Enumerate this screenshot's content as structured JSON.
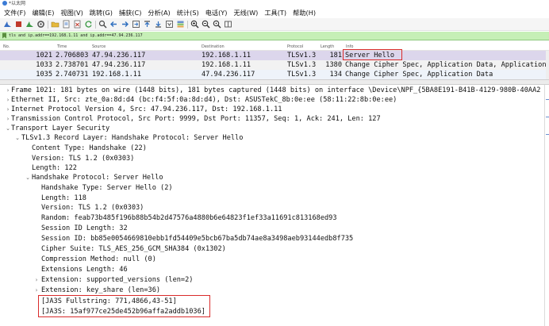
{
  "window": {
    "title": "*以太网"
  },
  "menu": [
    "文件(F)",
    "编辑(E)",
    "视图(V)",
    "跳转(G)",
    "捕获(C)",
    "分析(A)",
    "统计(S)",
    "电话(Y)",
    "无线(W)",
    "工具(T)",
    "帮助(H)"
  ],
  "toolbar": {
    "icons": [
      "shark-fin-icon",
      "stop-icon",
      "restart-icon",
      "options-gear-icon",
      "open-folder-icon",
      "save-file-icon",
      "close-file-icon",
      "reload-icon",
      "find-icon",
      "go-back-icon",
      "go-forward-icon",
      "jump-to-icon",
      "go-first-icon",
      "go-last-icon",
      "autoscroll-icon",
      "colorize-icon",
      "zoom-in-icon",
      "zoom-out-icon",
      "zoom-normal-icon",
      "resize-columns-icon"
    ]
  },
  "filter": {
    "text": "tls and ip.addr==192.168.1.11 and ip.addr==47.94.236.117"
  },
  "columns": {
    "no": "No.",
    "time": "Time",
    "source": "Source",
    "destination": "Destination",
    "protocol": "Protocol",
    "length": "Length",
    "info": "Info"
  },
  "packets": [
    {
      "no": "1021",
      "time": "2.706803",
      "source": "47.94.236.117",
      "destination": "192.168.1.11",
      "protocol": "TLSv1.3",
      "length": "181",
      "info": "Server Hello"
    },
    {
      "no": "1033",
      "time": "2.738701",
      "source": "47.94.236.117",
      "destination": "192.168.1.11",
      "protocol": "TLSv1.3",
      "length": "1380",
      "info": "Change Cipher Spec, Application Data, Application"
    },
    {
      "no": "1035",
      "time": "2.740731",
      "source": "192.168.1.11",
      "destination": "47.94.236.117",
      "protocol": "TLSv1.3",
      "length": "134",
      "info": "Change Cipher Spec, Application Data"
    }
  ],
  "details": [
    {
      "text": "Frame 1021: 181 bytes on wire (1448 bits), 181 bytes captured (1448 bits) on interface \\Device\\NPF_{5BA8E191-B41B-4129-980B-40AA2",
      "arrow": "›"
    },
    {
      "text": "Ethernet II, Src: zte_0a:8d:d4 (bc:f4:5f:0a:8d:d4), Dst: ASUSTekC_8b:0e:ee (58:11:22:8b:0e:ee)",
      "arrow": "›"
    },
    {
      "text": "Internet Protocol Version 4, Src: 47.94.236.117, Dst: 192.168.1.11",
      "arrow": "›"
    },
    {
      "text": "Transmission Control Protocol, Src Port: 9999, Dst Port: 11357, Seq: 1, Ack: 241, Len: 127",
      "arrow": "›"
    },
    {
      "text": "Transport Layer Security",
      "arrow": "⌄"
    },
    {
      "text": "TLSv1.3 Record Layer: Handshake Protocol: Server Hello",
      "arrow": "⌄"
    },
    {
      "text": "Content Type: Handshake (22)",
      "arrow": ""
    },
    {
      "text": "Version: TLS 1.2 (0x0303)",
      "arrow": ""
    },
    {
      "text": "Length: 122",
      "arrow": ""
    },
    {
      "text": "Handshake Protocol: Server Hello",
      "arrow": "⌄"
    },
    {
      "text": "Handshake Type: Server Hello (2)",
      "arrow": ""
    },
    {
      "text": "Length: 118",
      "arrow": ""
    },
    {
      "text": "Version: TLS 1.2 (0x0303)",
      "arrow": ""
    },
    {
      "text": "Random: feab73b485f196b88b54b2d47576a4880b6e64823f1ef33a11691c813168ed93",
      "arrow": ""
    },
    {
      "text": "Session ID Length: 32",
      "arrow": ""
    },
    {
      "text": "Session ID: bb85e0054669810ebb1fd54409e5bcb67ba5db74ae8a3498aeb93144edb8f735",
      "arrow": ""
    },
    {
      "text": "Cipher Suite: TLS_AES_256_GCM_SHA384 (0x1302)",
      "arrow": ""
    },
    {
      "text": "Compression Method: null (0)",
      "arrow": ""
    },
    {
      "text": "Extensions Length: 46",
      "arrow": ""
    },
    {
      "text": "Extension: supported_versions (len=2)",
      "arrow": "›"
    },
    {
      "text": "Extension: key_share (len=36)",
      "arrow": "›"
    },
    {
      "text": "[JA3S Fullstring: 771,4866,43-51]",
      "arrow": ""
    },
    {
      "text": "[JA3S: 15af977ce25de452b96affa2addb1036]",
      "arrow": ""
    }
  ],
  "colors": {
    "filter_bg": "#c6efb6",
    "selected_row": "#dcd6ec",
    "highlight_box": "#d92b2b"
  }
}
